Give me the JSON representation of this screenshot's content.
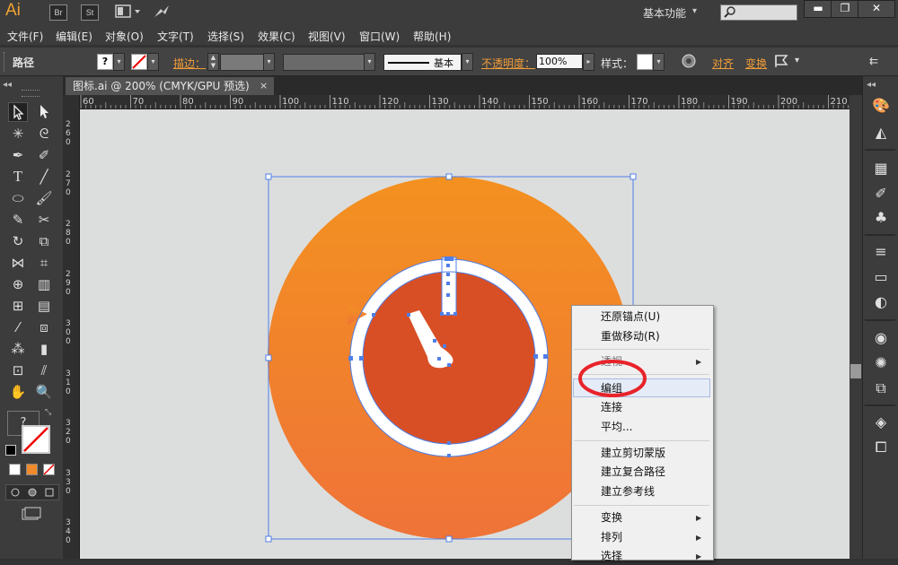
{
  "titlebar": {
    "logo": "Ai",
    "bridge_label": "Br",
    "stock_label": "St",
    "workspace": "基本功能",
    "search_placeholder": ""
  },
  "menu": [
    "文件(F)",
    "编辑(E)",
    "对象(O)",
    "文字(T)",
    "选择(S)",
    "效果(C)",
    "视图(V)",
    "窗口(W)",
    "帮助(H)"
  ],
  "control": {
    "object_type": "路径",
    "stroke_label": "描边：",
    "stroke_style": "基本",
    "opacity_label": "不透明度：",
    "opacity_value": "100%",
    "style_label": "样式：",
    "align_label": "对齐",
    "transform_label": "变换"
  },
  "document": {
    "tab_title": "图标.ai @ 200% (CMYK/GPU 预选)",
    "close": "×"
  },
  "ruler": {
    "h_ticks": [
      "60",
      "70",
      "80",
      "90",
      "100",
      "110",
      "120",
      "130",
      "140",
      "150",
      "160",
      "170",
      "180",
      "190",
      "200",
      "210"
    ],
    "v_ticks": [
      "2\n6\n0",
      "2\n7\n0",
      "2\n8\n0",
      "2\n9\n0",
      "3\n0\n0",
      "3\n1\n0",
      "3\n2\n0",
      "3\n3\n0",
      "3\n4\n0"
    ]
  },
  "context_menu": {
    "items": [
      {
        "label": "还原锚点(U)",
        "submenu": false
      },
      {
        "label": "重做移动(R)",
        "submenu": false
      },
      {
        "label": "透视",
        "submenu": true
      },
      {
        "label": "编组",
        "submenu": false
      },
      {
        "label": "连接",
        "submenu": false
      },
      {
        "label": "平均...",
        "submenu": false
      },
      {
        "label": "建立剪切蒙版",
        "submenu": false
      },
      {
        "label": "建立复合路径",
        "submenu": false
      },
      {
        "label": "建立参考线",
        "submenu": false
      },
      {
        "label": "变换",
        "submenu": true
      },
      {
        "label": "排列",
        "submenu": true
      },
      {
        "label": "选择",
        "submenu": true
      }
    ],
    "highlighted": "编组"
  },
  "colors": {
    "orange_top": "#f39120",
    "orange_bottom": "#ef7338",
    "inner_red": "#d94f25",
    "selection_blue": "#4f7fe8",
    "annotation_red": "#e8232a",
    "accent_link": "#f29d38"
  }
}
